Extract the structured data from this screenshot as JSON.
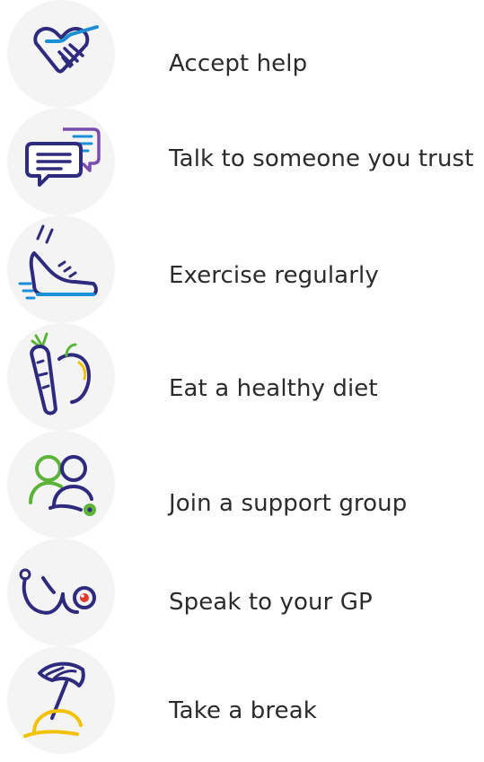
{
  "items": [
    {
      "icon": "handshake-heart-icon",
      "label": "Accept help"
    },
    {
      "icon": "chat-bubbles-icon",
      "label": "Talk to someone you trust"
    },
    {
      "icon": "running-shoe-icon",
      "label": "Exercise regularly"
    },
    {
      "icon": "carrot-apple-icon",
      "label": "Eat a healthy diet"
    },
    {
      "icon": "people-group-icon",
      "label": "Join a support group"
    },
    {
      "icon": "stethoscope-icon",
      "label": "Speak to your GP"
    },
    {
      "icon": "beach-umbrella-icon",
      "label": "Take a break"
    }
  ],
  "colors": {
    "navy": "#2e2a7d",
    "blue": "#1b8fd6",
    "purple": "#7b4cb0",
    "green": "#5cb33a",
    "yellow": "#f2c200",
    "red": "#e23b2e",
    "circle_bg": "#f4f4f5",
    "text": "#2b2b2b"
  }
}
